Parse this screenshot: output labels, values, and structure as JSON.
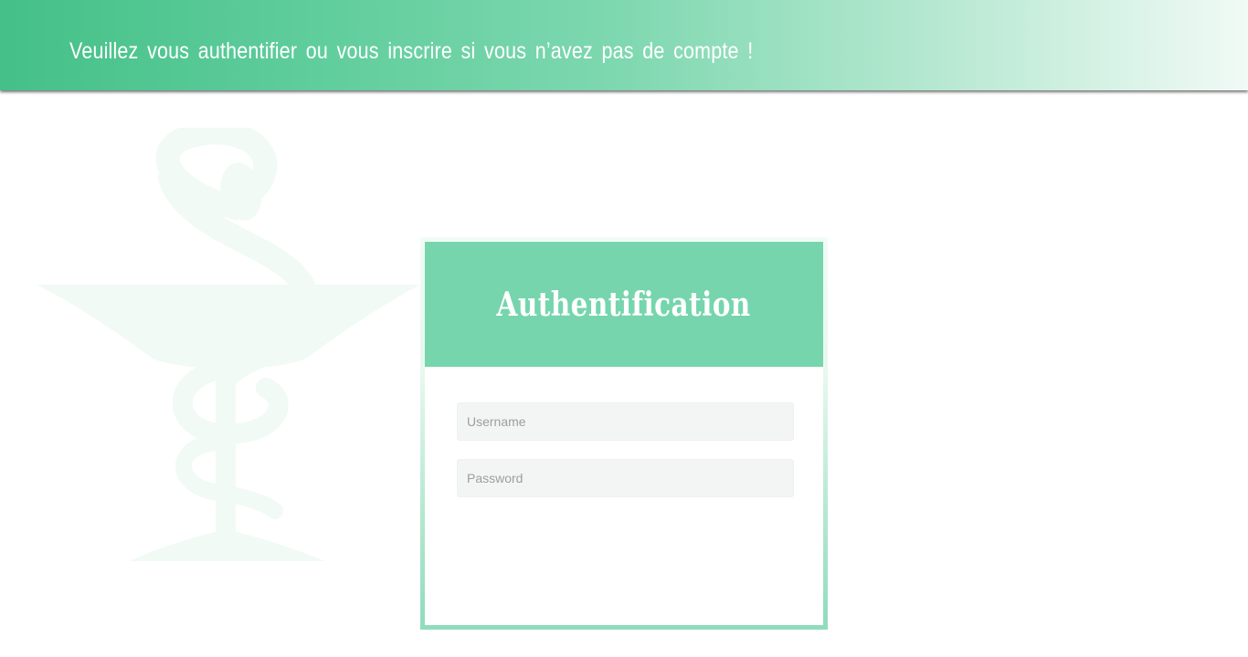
{
  "header": {
    "message": "Veuillez vous authentifier ou vous inscrire si vous n’avez pas de compte !"
  },
  "login_card": {
    "title": "Authentification",
    "username_placeholder": "Username",
    "username_value": "",
    "password_placeholder": "Password",
    "password_value": ""
  },
  "colors": {
    "brand_green": "#45c088",
    "header_green": "#76d5ad",
    "emblem_tint": "#f1faf5"
  },
  "icons": {
    "emblem": "pharmacy-bowl-of-hygieia-icon"
  }
}
